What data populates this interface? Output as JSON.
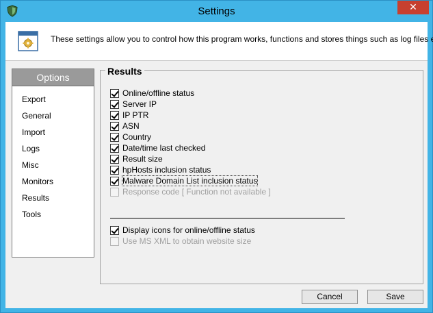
{
  "window": {
    "title": "Settings",
    "close_glyph": "✕"
  },
  "header": {
    "description": "These settings allow you to control how this program works, functions and stores things such as log files etc."
  },
  "options": {
    "title": "Options",
    "items": [
      "Export",
      "General",
      "Import",
      "Logs",
      "Misc",
      "Monitors",
      "Results",
      "Tools"
    ]
  },
  "results": {
    "title": "Results",
    "checkboxes": [
      {
        "label": "Online/offline status",
        "checked": true,
        "enabled": true
      },
      {
        "label": "Server IP",
        "checked": true,
        "enabled": true
      },
      {
        "label": "IP PTR",
        "checked": true,
        "enabled": true
      },
      {
        "label": "ASN",
        "checked": true,
        "enabled": true
      },
      {
        "label": "Country",
        "checked": true,
        "enabled": true
      },
      {
        "label": "Date/time last checked",
        "checked": true,
        "enabled": true
      },
      {
        "label": "Result size",
        "checked": true,
        "enabled": true
      },
      {
        "label": "hpHosts inclusion status",
        "checked": true,
        "enabled": true
      },
      {
        "label": "Malware Domain List inclusion status",
        "checked": true,
        "enabled": true
      },
      {
        "label": "Response code [ Function not available ]",
        "checked": false,
        "enabled": false
      }
    ],
    "display_checkboxes": [
      {
        "label": "Display icons for online/offline status",
        "checked": true,
        "enabled": true
      },
      {
        "label": "Use MS XML to obtain website size",
        "checked": false,
        "enabled": false
      }
    ]
  },
  "buttons": {
    "cancel": "Cancel",
    "save": "Save"
  },
  "colors": {
    "titlebar": "#42b4e6",
    "close": "#c7402f",
    "options_header": "#9a9a9a"
  }
}
